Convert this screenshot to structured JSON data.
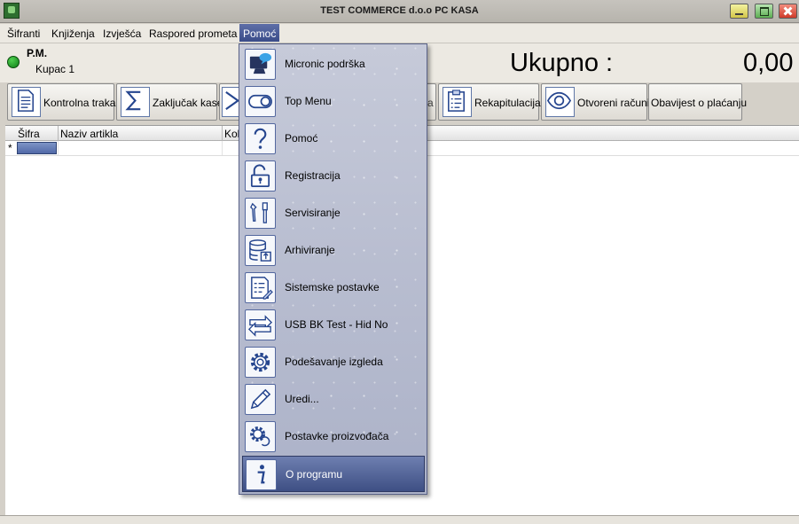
{
  "window": {
    "title": "TEST COMMERCE d.o.o PC KASA"
  },
  "menubar": {
    "items": [
      "Šifranti",
      "Knjiženja",
      "Izvješća",
      "Raspored prometa",
      "Pomoć"
    ]
  },
  "header": {
    "pm": "P.M.",
    "customer": "Kupac 1",
    "total_label": "Ukupno :",
    "total_value": "0,00"
  },
  "toolbar": {
    "buttons": [
      {
        "label": "Kontrolna traka",
        "icon": "document-icon"
      },
      {
        "label": "Zaključak kase",
        "icon": "sigma-icon"
      },
      {
        "label": "",
        "icon": "chevron-right-icon"
      },
      {
        "label": "a",
        "icon": "hidden"
      },
      {
        "label": "Rekapitulacija",
        "icon": "checklist-icon"
      },
      {
        "label": "Otvoreni računi",
        "icon": "eye-icon"
      },
      {
        "label": "Obavijest o plaćanju",
        "icon": "none"
      }
    ]
  },
  "grid": {
    "columns": [
      "Šifra",
      "Naziv artikla",
      "Koli"
    ],
    "row_marker": "*"
  },
  "dropdown": {
    "items": [
      {
        "label": "Micronic podrška",
        "icon": "support-monitor-icon"
      },
      {
        "label": "Top Menu",
        "icon": "toggle-icon"
      },
      {
        "label": "Pomoć",
        "icon": "question-icon"
      },
      {
        "label": "Registracija",
        "icon": "unlock-icon"
      },
      {
        "label": "Servisiranje",
        "icon": "tools-icon"
      },
      {
        "label": "Arhiviranje",
        "icon": "database-icon"
      },
      {
        "label": "Sistemske postavke",
        "icon": "settings-list-icon"
      },
      {
        "label": "USB BK Test - Hid No",
        "icon": "arrows-icon"
      },
      {
        "label": "Podešavanje izgleda",
        "icon": "gear-icon"
      },
      {
        "label": "Uredi...",
        "icon": "pencil-icon"
      },
      {
        "label": "Postavke proizvođača",
        "icon": "gear-refresh-icon"
      },
      {
        "label": "O programu",
        "icon": "info-icon",
        "selected": true
      }
    ]
  }
}
